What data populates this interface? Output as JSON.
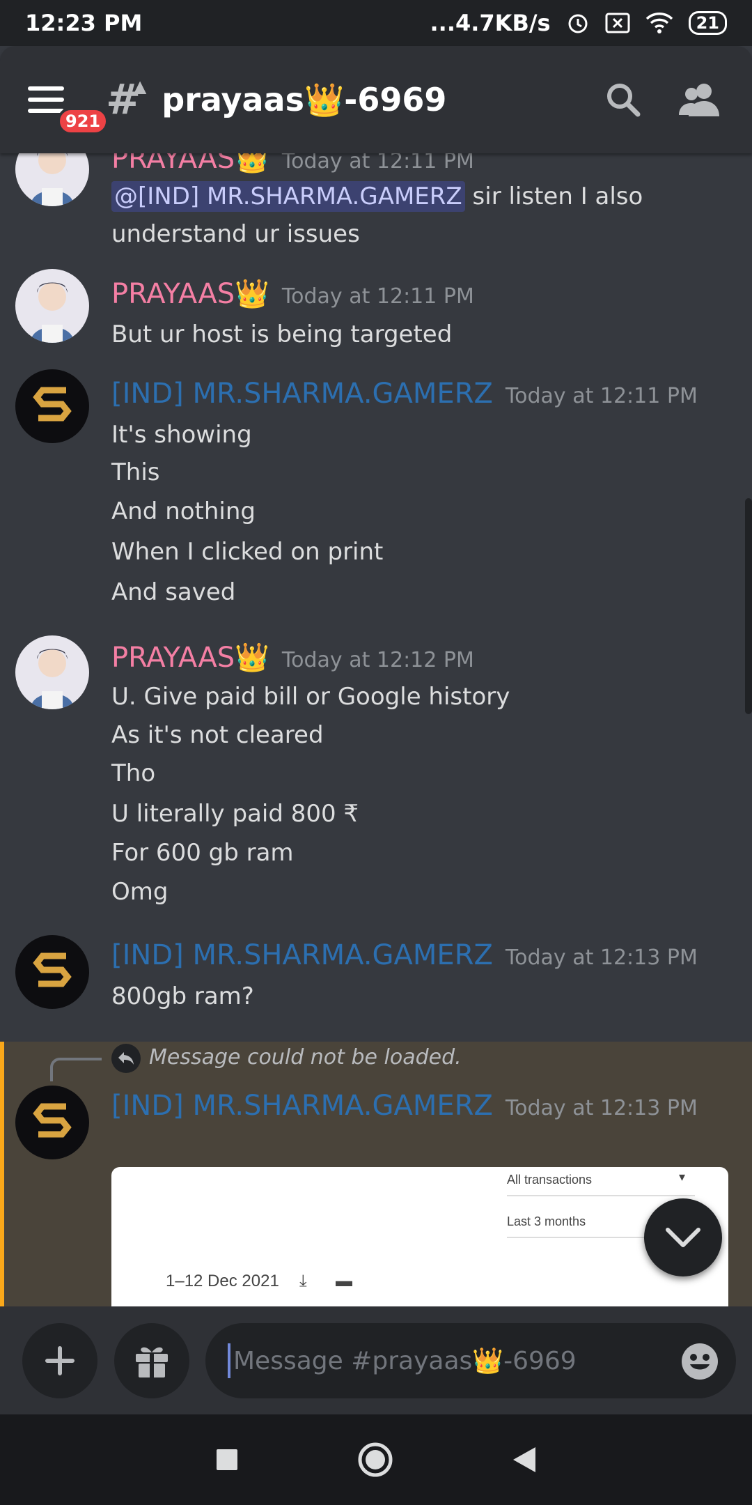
{
  "status_bar": {
    "time": "12:23 PM",
    "speed": "...4.7KB/s",
    "battery": "21"
  },
  "header": {
    "unread_badge": "921",
    "channel_name": "prayaas👑-6969"
  },
  "messages": [
    {
      "author": "PRAYAAS👑",
      "time": "Today at 12:11 PM",
      "mention": "@[IND] MR.SHARMA.GAMERZ",
      "lines": [
        "sir listen I also",
        "understand ur issues"
      ]
    },
    {
      "author": "PRAYAAS👑",
      "time": "Today at 12:11 PM",
      "lines": [
        "But ur host is being targeted"
      ]
    },
    {
      "author": "[IND] MR.SHARMA.GAMERZ",
      "time": "Today at 12:11 PM",
      "lines": [
        "It's showing",
        "This",
        "And nothing",
        "When I clicked on print",
        "And saved"
      ]
    },
    {
      "author": "PRAYAAS👑",
      "time": "Today at 12:12 PM",
      "lines": [
        "U. Give paid bill or Google history",
        "As it's not cleared",
        "Tho",
        "U literally paid 800 ₹",
        "For 600 gb ram",
        "Omg"
      ]
    },
    {
      "author": "[IND] MR.SHARMA.GAMERZ",
      "time": "Today at 12:13 PM",
      "lines": [
        "800gb ram?"
      ]
    },
    {
      "author": "[IND] MR.SHARMA.GAMERZ",
      "time": "Today at 12:13 PM",
      "reply_text": "Message could not be loaded."
    }
  ],
  "embed": {
    "filter": "All transactions",
    "range": "Last 3 months",
    "dates": "1–12 Dec 2021"
  },
  "composer": {
    "placeholder": "Message #prayaas👑-6969"
  },
  "colors": {
    "background": "#36393f",
    "header": "#2f3136",
    "mention_bg": "#3c4270",
    "pink_name": "#f47fa4",
    "blue_name": "#2c6fb0",
    "highlight": "#4a443a",
    "highlight_bar": "#faa81a"
  },
  "icons": [
    "menu-icon",
    "channel-hash-lock-icon",
    "search-icon",
    "members-icon",
    "reply-icon",
    "chevron-down-icon",
    "plus-icon",
    "gift-icon",
    "emoji-icon",
    "download-icon",
    "print-icon",
    "nav-square-icon",
    "nav-home-icon",
    "nav-back-icon"
  ]
}
